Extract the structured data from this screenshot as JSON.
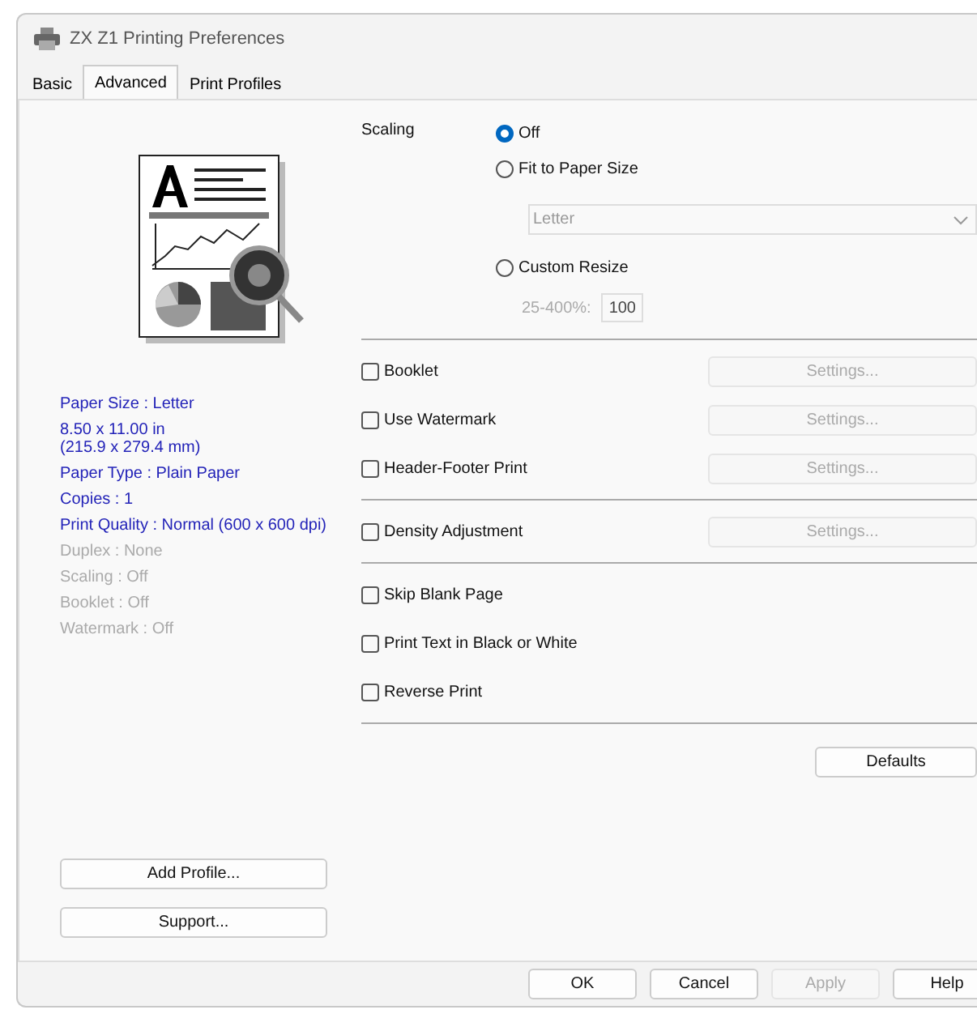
{
  "window": {
    "title": "ZX Z1 Printing Preferences"
  },
  "tabs": [
    {
      "label": "Basic",
      "selected": false
    },
    {
      "label": "Advanced",
      "selected": true
    },
    {
      "label": "Print Profiles",
      "selected": false
    }
  ],
  "summary": [
    {
      "text": "Paper Size : Letter",
      "disabled": false
    },
    {
      "text": "8.50 x 11.00 in\n(215.9 x 279.4 mm)",
      "disabled": false
    },
    {
      "text": "Paper Type : Plain Paper",
      "disabled": false
    },
    {
      "text": "Copies : 1",
      "disabled": false
    },
    {
      "text": "Print Quality : Normal (600 x 600 dpi)",
      "disabled": false
    },
    {
      "text": "Duplex : None",
      "disabled": true
    },
    {
      "text": "Scaling : Off",
      "disabled": true
    },
    {
      "text": "Booklet : Off",
      "disabled": true
    },
    {
      "text": "Watermark : Off",
      "disabled": true
    }
  ],
  "profile_buttons": [
    "Add Profile...",
    "Support..."
  ],
  "scaling": {
    "label": "Scaling",
    "options": [
      {
        "label": "Off",
        "selected": true
      },
      {
        "label": "Fit to Paper Size",
        "selected": false,
        "dropdown": {
          "value": "Letter",
          "disabled": true
        }
      },
      {
        "label": "Custom Resize",
        "selected": false,
        "entry": {
          "label": "25-400%:",
          "value": "100",
          "disabled": true
        }
      }
    ]
  },
  "option_groups": [
    [
      {
        "label": "Booklet",
        "checked": false,
        "settings": {
          "label": "Settings...",
          "disabled": true
        }
      },
      {
        "label": "Use Watermark",
        "checked": false,
        "settings": {
          "label": "Settings...",
          "disabled": true
        }
      },
      {
        "label": "Header-Footer Print",
        "checked": false,
        "settings": {
          "label": "Settings...",
          "disabled": true
        }
      }
    ],
    [
      {
        "label": "Density Adjustment",
        "checked": false,
        "settings": {
          "label": "Settings...",
          "disabled": true
        }
      }
    ],
    [
      {
        "label": "Skip Blank Page",
        "checked": false
      },
      {
        "label": "Print Text in Black or White",
        "checked": false
      },
      {
        "label": "Reverse Print",
        "checked": false
      }
    ]
  ],
  "defaults_button": "Defaults",
  "dialog_buttons": [
    {
      "label": "OK",
      "disabled": false
    },
    {
      "label": "Cancel",
      "disabled": false
    },
    {
      "label": "Apply",
      "disabled": true
    },
    {
      "label": "Help",
      "disabled": false
    }
  ]
}
